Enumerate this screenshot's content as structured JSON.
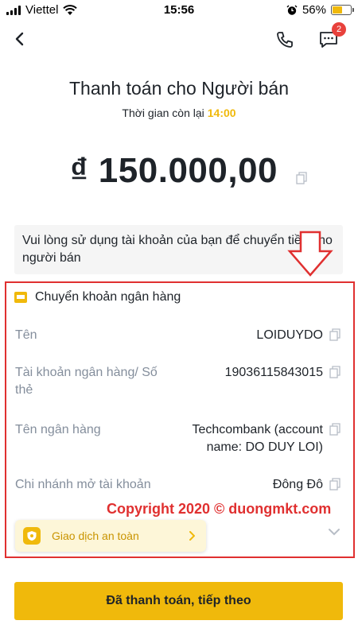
{
  "status_bar": {
    "carrier": "Viettel",
    "time": "15:56",
    "battery": "56%",
    "battery_level": 0.56
  },
  "nav": {
    "chat_badge": "2"
  },
  "header": {
    "title": "Thanh toán cho Người bán",
    "timer_label": "Thời gian còn lại",
    "timer_value": "14:00"
  },
  "amount": "₫ 150.000,00",
  "notice": "Vui lòng sử dụng tài khoản của bạn để chuyển tiền cho người bán",
  "payment_method": {
    "title": "Chuyển khoản ngân hàng",
    "fields": [
      {
        "label": "Tên",
        "value": "LOIDUYDO"
      },
      {
        "label": "Tài khoản ngân hàng/ Số thẻ",
        "value": "19036115843015"
      },
      {
        "label": "Tên ngân hàng",
        "value": "Techcombank (account name: DO DUY LOI)"
      },
      {
        "label": "Chi nhánh mở tài khoản",
        "value": "Đông Đô"
      }
    ]
  },
  "watermark": "Copyright 2020 © duongmkt.com",
  "safe_trade": "Giao dịch an toàn",
  "primary_button": "Đã thanh toán, tiếp theo",
  "colors": {
    "accent": "#f0b90b",
    "badge": "#e8413c",
    "annotation": "#e03030"
  }
}
